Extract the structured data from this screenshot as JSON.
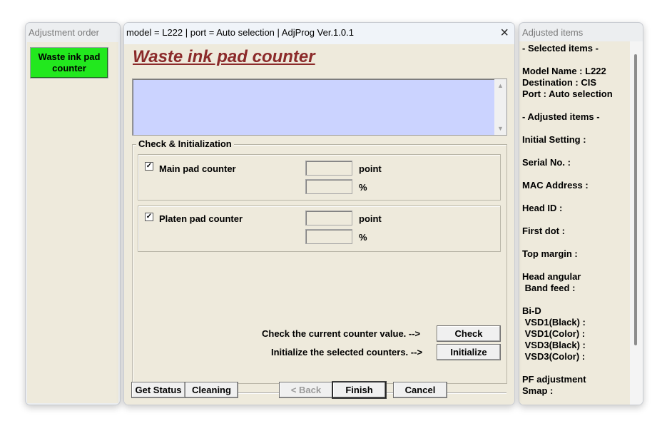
{
  "left_window": {
    "title": "Adjustment order",
    "waste_button": "Waste ink pad counter"
  },
  "dialog": {
    "title": "model = L222 | port = Auto selection | AdjProg Ver.1.0.1",
    "close_icon": "×",
    "heading": "Waste ink pad counter",
    "log_text": "",
    "group": {
      "legend": "Check & Initialization",
      "main": {
        "checked": true,
        "label": "Main pad counter",
        "point_value": "",
        "percent_value": "",
        "unit_point": "point",
        "unit_percent": "%"
      },
      "platen": {
        "checked": true,
        "label": "Platen pad counter",
        "point_value": "",
        "percent_value": "",
        "unit_point": "point",
        "unit_percent": "%"
      },
      "check_text": "Check the current counter value.  -->",
      "check_button": "Check",
      "init_text": "Initialize the selected counters.  -->",
      "init_button": "Initialize"
    },
    "footer": {
      "get_status": "Get Status",
      "cleaning": "Cleaning",
      "back": "< Back",
      "finish": "Finish",
      "cancel": "Cancel"
    }
  },
  "right_window": {
    "title": "Adjusted items",
    "lines": [
      "- Selected items -",
      "Model Name : L222",
      "Destination : CIS",
      "Port : Auto selection",
      "- Adjusted items -",
      "Initial Setting :",
      "Serial No. :",
      "MAC Address :",
      "Head ID :",
      "First dot :",
      "Top margin :",
      "Head angular",
      " Band feed :",
      "Bi-D",
      " VSD1(Black) :",
      " VSD1(Color) :",
      " VSD3(Black) :",
      " VSD3(Color) :",
      "PF adjustment",
      "Smap :"
    ]
  }
}
